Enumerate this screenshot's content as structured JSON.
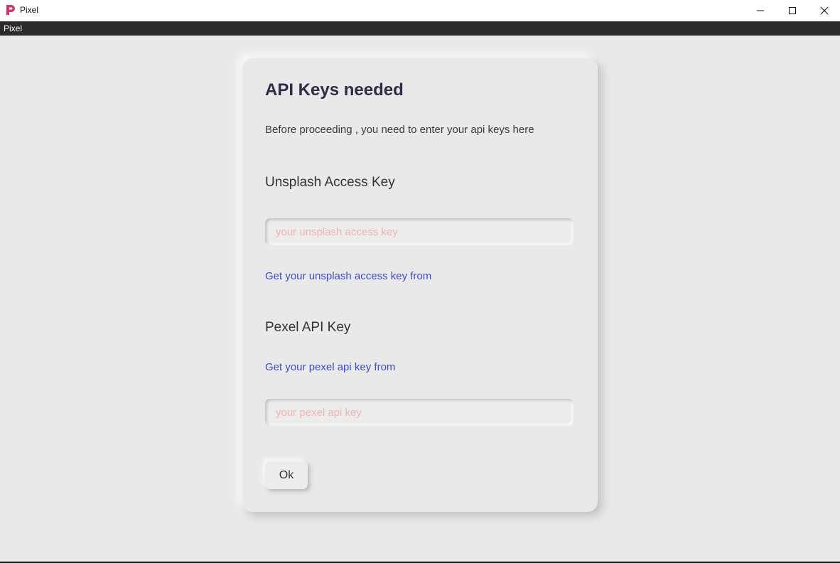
{
  "window": {
    "title": "Pixel",
    "logo_icon": "pixel-logo-icon",
    "logo_color": "#d8316a",
    "controls": {
      "minimize_icon": "minimize-icon",
      "maximize_icon": "maximize-icon",
      "close_icon": "close-icon"
    }
  },
  "menubar": {
    "items": [
      {
        "label": "Pixel"
      }
    ]
  },
  "dialog": {
    "title": "API Keys needed",
    "description": "Before proceeding , you need to enter your api keys here",
    "unsplash": {
      "label": "Unsplash Access Key",
      "placeholder": "your unsplash access key",
      "value": "",
      "help_link": "Get your unsplash access key from"
    },
    "pexel": {
      "label": "Pexel API Key",
      "help_link": "Get your pexel api key from",
      "placeholder": "your pexel api key",
      "value": ""
    },
    "ok_label": "Ok"
  },
  "colors": {
    "background": "#e9e9e9",
    "title_text": "#2d2d48",
    "link": "#3a4cd0",
    "placeholder": "#f0b3b3",
    "menubar": "#2b2b2b"
  }
}
